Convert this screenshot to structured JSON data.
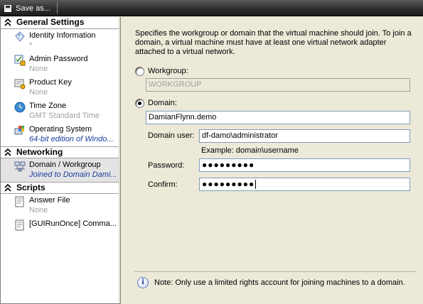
{
  "toolbar": {
    "save_label": "Save as..."
  },
  "nav": {
    "sections": [
      {
        "title": "General Settings"
      },
      {
        "title": "Networking"
      },
      {
        "title": "Scripts"
      }
    ],
    "items": [
      {
        "label": "Identity Information",
        "sub": "*"
      },
      {
        "label": "Admin Password",
        "sub": "None"
      },
      {
        "label": "Product Key",
        "sub": "None"
      },
      {
        "label": "Time Zone",
        "sub": "GMT Standard Time"
      },
      {
        "label": "Operating System",
        "sub": "64-bit edition of Windo..."
      },
      {
        "label": "Domain / Workgroup",
        "sub": "Joined to Domain Dami..."
      },
      {
        "label": "Answer File",
        "sub": "None"
      },
      {
        "label": "[GUIRunOnce] Comma...",
        "sub": ""
      }
    ]
  },
  "panel": {
    "description": "Specifies the workgroup or domain that the virtual machine should join.  To join a domain, a virtual machine must have at least one virtual network adapter attached to a virtual network.",
    "workgroup_label": "Workgroup:",
    "workgroup_value": "WORKGROUP",
    "domain_label": "Domain:",
    "domain_value": "DamianFlynn.demo",
    "domain_user_label": "Domain user:",
    "domain_user_value": "df-damo\\administrator",
    "example": "Example: domain\\username",
    "password_label": "Password:",
    "password_value": "●●●●●●●●●",
    "confirm_label": "Confirm:",
    "confirm_value": "●●●●●●●●●",
    "note": "Note: Only use a limited rights account for joining machines to a domain."
  }
}
